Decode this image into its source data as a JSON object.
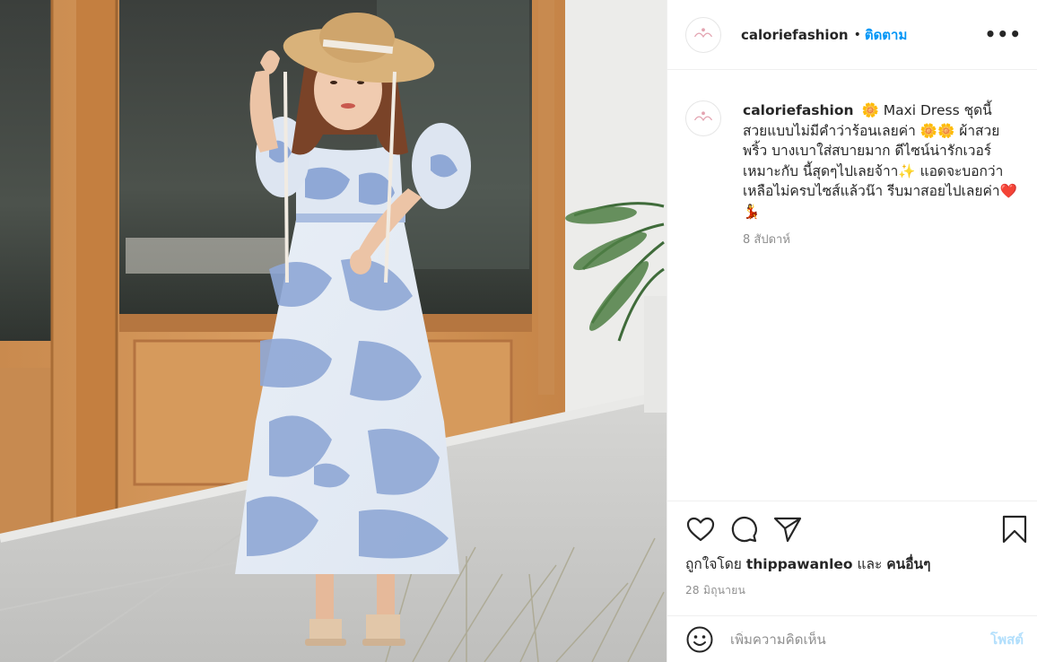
{
  "post": {
    "username": "caloriefashion",
    "separator": "•",
    "follow_label": "ติดตาม",
    "more_label": "•••",
    "caption_username": "caloriefashion",
    "caption_text": "🌼 Maxi Dress ชุดนี้ สวยแบบไม่มีคำว่าร้อนเลยค่า 🌼🌼 ผ้าสวยพริ้ว บางเบาใส่สบายมาก ดีไซน์น่ารักเวอร์ เหมาะกับ นี้สุดๆไปเลยจ้าา✨ แอดจะบอกว่าเหลือไม่ครบไซส์แล้วน๊า รีบมาสอยไปเลยค่า❤️💃",
    "time_ago": "8 สัปดาห์",
    "likes_prefix": "ถูกใจโดย",
    "likes_user": "thippawanleo",
    "likes_and": "และ",
    "likes_others": "คนอื่นๆ",
    "date": "28 มิถุนายน"
  },
  "comment": {
    "placeholder": "เพิ่มความคิดเห็น",
    "post_label": "โพสต์"
  },
  "icons": {
    "like": "heart-icon",
    "comment": "comment-icon",
    "share": "share-icon",
    "save": "bookmark-icon",
    "emoji": "emoji-icon"
  },
  "colors": {
    "link": "#0095f6",
    "post_disabled": "#b2dffc",
    "muted": "#8e8e8e"
  }
}
